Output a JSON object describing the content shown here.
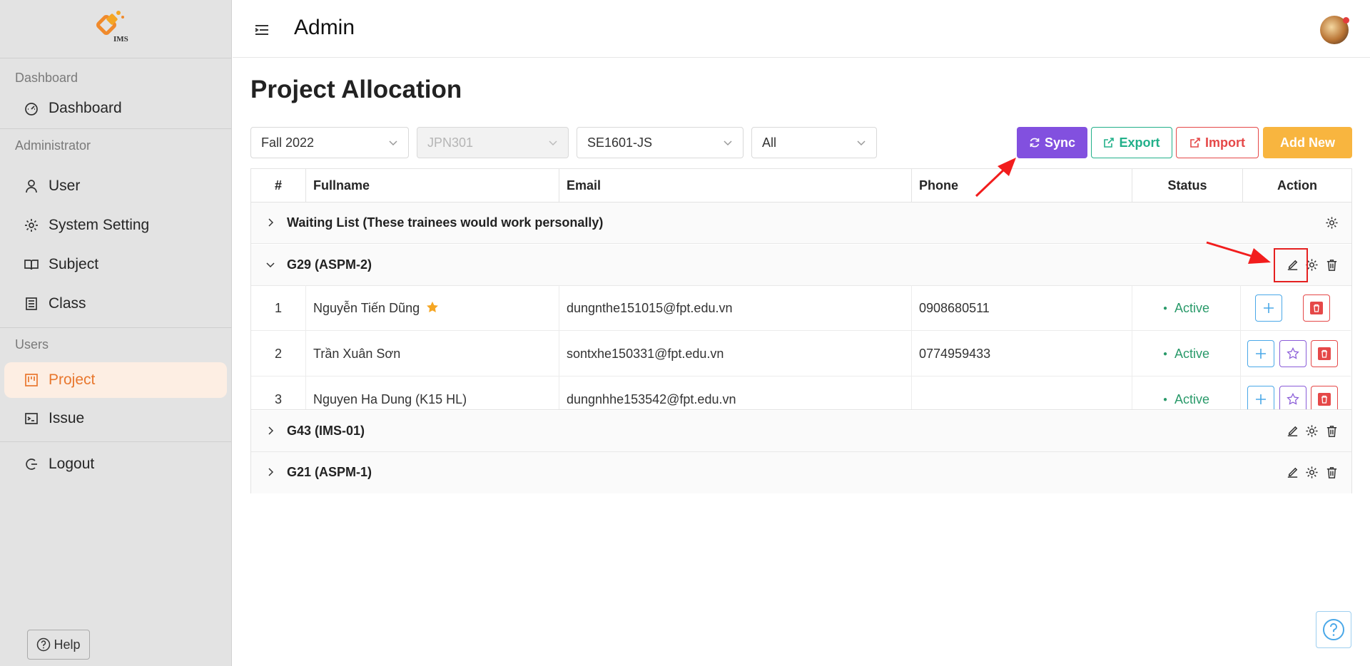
{
  "brand": {
    "logo_text": "IMS"
  },
  "sidebar": {
    "sections": [
      {
        "label": "Dashboard",
        "items": [
          {
            "label": "Dashboard",
            "icon": "dashboard-icon"
          }
        ]
      },
      {
        "label": "Administrator",
        "items": [
          {
            "label": "User",
            "icon": "user-icon"
          },
          {
            "label": "System Setting",
            "icon": "gear-icon"
          },
          {
            "label": "Subject",
            "icon": "book-icon"
          },
          {
            "label": "Class",
            "icon": "class-icon"
          }
        ]
      },
      {
        "label": "Users",
        "items": [
          {
            "label": "Project",
            "icon": "project-icon",
            "active": true
          },
          {
            "label": "Issue",
            "icon": "terminal-icon"
          }
        ]
      }
    ],
    "logout": "Logout",
    "help": "Help"
  },
  "header": {
    "title": "Admin"
  },
  "page": {
    "title": "Project Allocation"
  },
  "filters": {
    "semester": "Fall 2022",
    "subject": "JPN301",
    "class": "SE1601-JS",
    "status": "All"
  },
  "toolbar": {
    "sync": "Sync",
    "export": "Export",
    "import": "Import",
    "add_new": "Add New"
  },
  "table": {
    "headers": {
      "index": "#",
      "fullname": "Fullname",
      "email": "Email",
      "phone": "Phone",
      "status": "Status",
      "action": "Action"
    },
    "groups": [
      {
        "title": "Waiting List (These trainees would work personally)",
        "expanded": false
      },
      {
        "title": "G29 (ASPM-2)",
        "expanded": true
      },
      {
        "title": "G43 (IMS-01)",
        "expanded": false
      },
      {
        "title": "G21 (ASPM-1)",
        "expanded": false
      }
    ],
    "rows": [
      {
        "index": "1",
        "fullname": "Nguyễn Tiến Dũng",
        "leader": true,
        "email": "dungnthe151015@fpt.edu.vn",
        "phone": "0908680511",
        "status": "Active"
      },
      {
        "index": "2",
        "fullname": "Trần Xuân Sơn",
        "leader": false,
        "email": "sontxhe150331@fpt.edu.vn",
        "phone": "0774959433",
        "status": "Active"
      },
      {
        "index": "3",
        "fullname": "Nguyen Ha Dung (K15 HL)",
        "leader": false,
        "email": "dungnhhe153542@fpt.edu.vn",
        "phone": "",
        "status": "Active"
      }
    ]
  },
  "colors": {
    "accent": "#e8772e",
    "sync": "#8250df",
    "export": "#22b08a",
    "import": "#e54848",
    "add": "#f8b53f",
    "active": "#2a9a6a"
  }
}
